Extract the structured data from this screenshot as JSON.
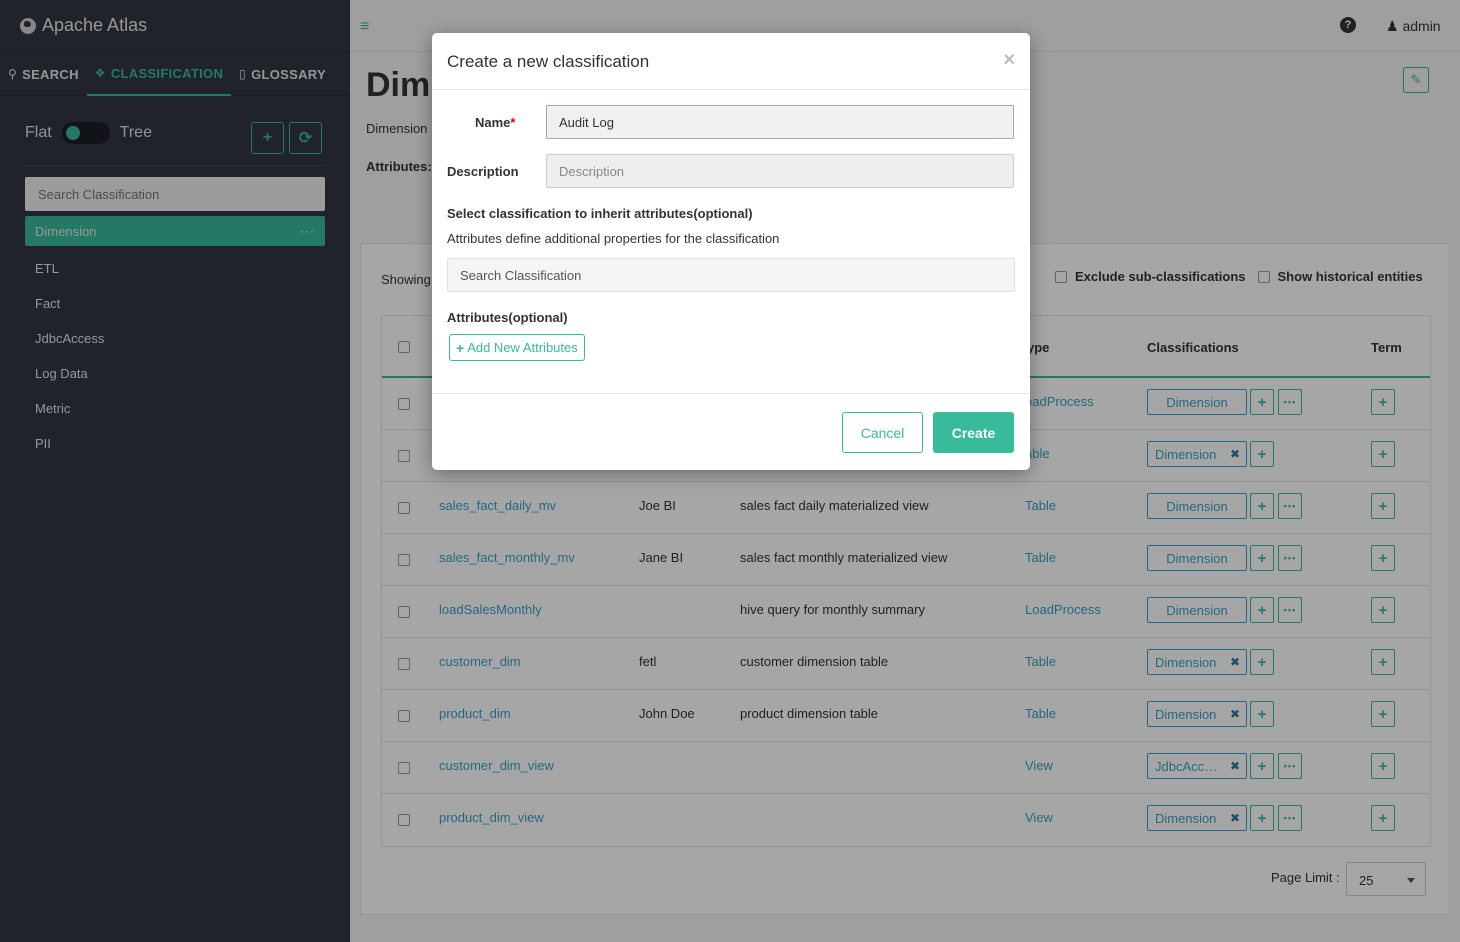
{
  "app": {
    "title": "Apache Atlas"
  },
  "nav": {
    "tabs": [
      {
        "label": "SEARCH"
      },
      {
        "label": "CLASSIFICATION"
      },
      {
        "label": "GLOSSARY"
      }
    ]
  },
  "sidebar": {
    "mode_flat": "Flat",
    "mode_tree": "Tree",
    "add_icon": "+",
    "refresh_icon": "⟳",
    "search_placeholder": "Search Classification",
    "items": [
      {
        "label": "Dimension",
        "menu": "···"
      },
      {
        "label": "ETL"
      },
      {
        "label": "Fact"
      },
      {
        "label": "JdbcAccess"
      },
      {
        "label": "Log Data"
      },
      {
        "label": "Metric"
      },
      {
        "label": "PII"
      }
    ]
  },
  "topbar": {
    "user": "admin",
    "help": "?",
    "menu_icon": "≡"
  },
  "page": {
    "title": "Dim",
    "subtitle": "Dimension",
    "attributes_label": "Attributes:",
    "edit_icon": "✎",
    "showing": "Showing",
    "exclude_sub": "Exclude sub-classifications",
    "show_historical": "Show historical entities",
    "columns": {
      "type": "ype",
      "classifications": "Classifications",
      "term": "Term"
    },
    "rows": [
      {
        "name": "",
        "owner": "",
        "description": "",
        "type": "oadProcess",
        "tag": "Dimension",
        "removable": false,
        "more": true
      },
      {
        "name": "",
        "owner": "",
        "description": "",
        "type": "able",
        "tag": "Dimension",
        "removable": true,
        "more": false
      },
      {
        "name": "sales_fact_daily_mv",
        "owner": "Joe BI",
        "description": "sales fact daily materialized view",
        "type": "Table",
        "tag": "Dimension",
        "removable": false,
        "more": true
      },
      {
        "name": "sales_fact_monthly_mv",
        "owner": "Jane BI",
        "description": "sales fact monthly materialized view",
        "type": "Table",
        "tag": "Dimension",
        "removable": false,
        "more": true
      },
      {
        "name": "loadSalesMonthly",
        "owner": "",
        "description": "hive query for monthly summary",
        "type": "LoadProcess",
        "tag": "Dimension",
        "removable": false,
        "more": true
      },
      {
        "name": "customer_dim",
        "owner": "fetl",
        "description": "customer dimension table",
        "type": "Table",
        "tag": "Dimension",
        "removable": true,
        "more": false
      },
      {
        "name": "product_dim",
        "owner": "John Doe",
        "description": "product dimension table",
        "type": "Table",
        "tag": "Dimension",
        "removable": true,
        "more": false
      },
      {
        "name": "customer_dim_view",
        "owner": "",
        "description": "",
        "type": "View",
        "tag": "JdbcAcc…",
        "removable": true,
        "more": true
      },
      {
        "name": "product_dim_view",
        "owner": "",
        "description": "",
        "type": "View",
        "tag": "Dimension",
        "removable": true,
        "more": true
      }
    ],
    "page_limit_label": "Page Limit :",
    "page_limit_value": "25"
  },
  "modal": {
    "title": "Create a new classification",
    "close": "×",
    "name_label": "Name",
    "required_mark": "*",
    "name_value": "Audit Log",
    "description_label": "Description",
    "description_placeholder": "Description",
    "inherit_title": "Select classification to inherit attributes(optional)",
    "inherit_desc": "Attributes define additional properties for the classification",
    "inherit_search_placeholder": "Search Classification",
    "attributes_title": "Attributes(optional)",
    "add_attributes": "Add New Attributes",
    "cancel": "Cancel",
    "create": "Create"
  },
  "colors": {
    "accent": "#37bb9b",
    "link": "#37a1c8",
    "sidebar": "#323544"
  }
}
